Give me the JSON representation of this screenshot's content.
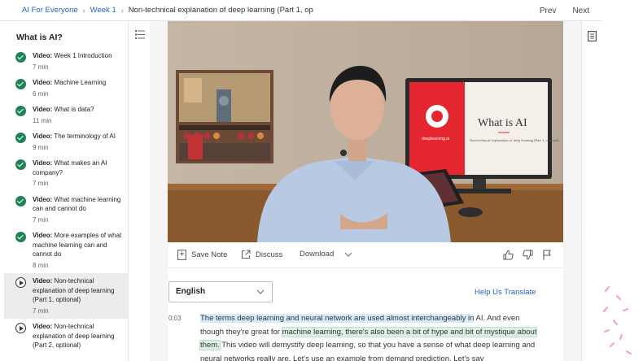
{
  "breadcrumb": {
    "items": [
      "AI For Everyone",
      "Week 1",
      "Non-technical explanation of deep learning (Part 1, op"
    ]
  },
  "nav": {
    "prev": "Prev",
    "next": "Next"
  },
  "sidebar": {
    "title": "What is AI?",
    "items": [
      {
        "label": "Video:",
        "title": "Week 1 Introduction",
        "duration": "7 min",
        "status": "complete"
      },
      {
        "label": "Video:",
        "title": "Machine Learning",
        "duration": "6 min",
        "status": "complete"
      },
      {
        "label": "Video:",
        "title": "What is data?",
        "duration": "11 min",
        "status": "complete"
      },
      {
        "label": "Video:",
        "title": "The terminology of AI",
        "duration": "9 min",
        "status": "complete"
      },
      {
        "label": "Video:",
        "title": "What makes an AI company?",
        "duration": "7 min",
        "status": "complete"
      },
      {
        "label": "Video:",
        "title": "What machine learning can and cannot do",
        "duration": "7 min",
        "status": "complete"
      },
      {
        "label": "Video:",
        "title": "More examples of what machine learning can and cannot do",
        "duration": "8 min",
        "status": "complete"
      },
      {
        "label": "Video:",
        "title": "Non-technical explanation of deep learning (Part 1, optional)",
        "duration": "7 min",
        "status": "current"
      },
      {
        "label": "Video:",
        "title": "Non-technical explanation of deep learning (Part 2, optional)",
        "duration": "",
        "status": "not-started"
      }
    ]
  },
  "video": {
    "slide_title": "What is AI",
    "slide_subtitle": "Non-technical explanation of deep learning (Part 1, optional)",
    "slide_brand": "deeplearning.ai"
  },
  "toolbar": {
    "save_note": "Save Note",
    "discuss": "Discuss",
    "download": "Download"
  },
  "transcript": {
    "language": "English",
    "help_translate": "Help Us Translate",
    "timestamp": "0:03",
    "seg1": "The terms deep learning and neural network are used almost interchangeably in",
    "seg2": " AI. And even though they're great for ",
    "seg3": "machine learning, there's also been a bit of hype and bit of mystique about them.",
    "seg4": " This video will demystify deep learning, so that you have a sense of what deep learning and neural networks really are. Let's use an example from demand prediction. Let's say"
  },
  "colors": {
    "accent_blue": "#1f61c4",
    "complete_green": "#1f8354",
    "slide_red": "#e3262f"
  }
}
